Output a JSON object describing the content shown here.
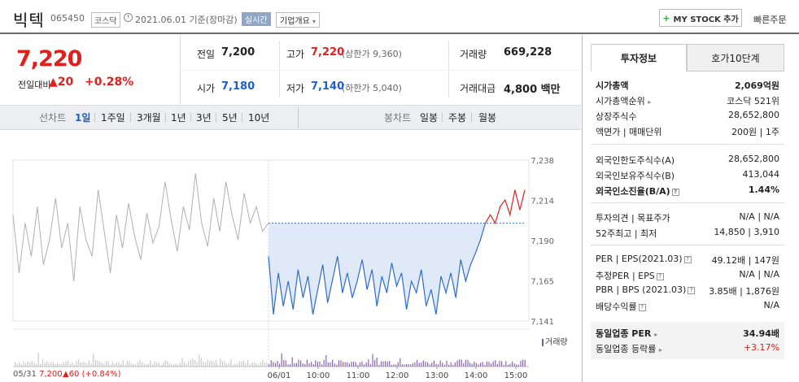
{
  "header": {
    "name": "빅텍",
    "code": "065450",
    "market": "코스닥",
    "date_text": "2021.06.01 기준(장마감)",
    "realtime": "실시간",
    "company_info": "기업개요",
    "mystock": "MY STOCK 추가",
    "quick_order": "빠른주문"
  },
  "price": {
    "current": "7,220",
    "change_label": "전일대비",
    "change_value": "20",
    "change_pct": "+0.28%"
  },
  "info": {
    "prev_label": "전일",
    "prev": "7,200",
    "open_label": "시가",
    "open": "7,180",
    "high_label": "고가",
    "high": "7,220",
    "upper_limit": "(상한가 9,360)",
    "low_label": "저가",
    "low": "7,140",
    "lower_limit": "(하한가 5,040)",
    "volume_label": "거래량",
    "volume": "669,228",
    "amount_label": "거래대금",
    "amount": "4,800 백만"
  },
  "period_tabs": {
    "label": "선차트",
    "items": [
      "1일",
      "1주일",
      "3개월",
      "1년",
      "3년",
      "5년",
      "10년"
    ],
    "active": "1일",
    "candle_label": "봉차트",
    "candle_items": [
      "일봉",
      "주봉",
      "월봉"
    ]
  },
  "chart_data": {
    "type": "line",
    "prev_close": 7200,
    "ylim": [
      7141,
      7238
    ],
    "y_ticks": [
      "7,238",
      "7,214",
      "7,190",
      "7,165",
      "7,141"
    ],
    "x_ticks": [
      "06/01",
      "10:00",
      "11:00",
      "12:00",
      "13:00",
      "14:00",
      "15:00"
    ],
    "volume_legend": "거래량",
    "footer_date": "05/31",
    "footer_price": "7,200",
    "footer_change": "▲60 (+0.84%)",
    "prev_day_series": [
      7205,
      7170,
      7200,
      7180,
      7210,
      7175,
      7190,
      7215,
      7185,
      7200,
      7165,
      7210,
      7190,
      7180,
      7220,
      7195,
      7170,
      7205,
      7185,
      7212,
      7192,
      7178,
      7206,
      7188,
      7198,
      7225,
      7202,
      7183,
      7210,
      7196,
      7230,
      7200,
      7186,
      7215,
      7195,
      7225,
      7205,
      7190,
      7218,
      7200,
      7210,
      7195,
      7200
    ],
    "today_series": [
      7180,
      7145,
      7170,
      7150,
      7165,
      7148,
      7172,
      7155,
      7168,
      7145,
      7160,
      7175,
      7152,
      7166,
      7180,
      7158,
      7170,
      7155,
      7165,
      7178,
      7160,
      7172,
      7150,
      7168,
      7158,
      7176,
      7162,
      7170,
      7148,
      7165,
      7158,
      7172,
      7150,
      7160,
      7145,
      7168,
      7158,
      7170,
      7155,
      7178,
      7165,
      7175,
      7182,
      7190,
      7200,
      7205,
      7200,
      7210,
      7214,
      7205,
      7220,
      7208,
      7220
    ]
  },
  "right": {
    "tab_invest": "투자정보",
    "tab_hoga": "호가10단계",
    "rows1": [
      {
        "label": "시가총액",
        "value": "2,069억원"
      },
      {
        "label": "시가총액순위",
        "value": "코스닥 521위"
      },
      {
        "label": "상장주식수",
        "value": "28,652,800"
      },
      {
        "label": "액면가 | 매매단위",
        "value": "200원 | 1주"
      }
    ],
    "rows2": [
      {
        "label": "외국인한도주식수(A)",
        "value": "28,652,800"
      },
      {
        "label": "외국인보유주식수(B)",
        "value": "413,044"
      },
      {
        "label": "외국인소진율(B/A)",
        "value": "1.44%"
      }
    ],
    "rows3": [
      {
        "label": "투자의견 | 목표주가",
        "value": "N/A | N/A"
      },
      {
        "label": "52주최고 | 최저",
        "value": "14,850 | 3,910"
      }
    ],
    "rows4": [
      {
        "label": "PER | EPS(2021.03)",
        "value": "49.12배 | 147원"
      },
      {
        "label": "추정PER | EPS",
        "value": "N/A | N/A"
      },
      {
        "label": "PBR | BPS (2021.03)",
        "value": "3.85배 | 1,876원"
      },
      {
        "label": "배당수익률",
        "value": "N/A"
      }
    ],
    "sector_per_label": "동일업종 PER",
    "sector_per": "34.94배",
    "sector_rate_label": "동일업종 등락률",
    "sector_rate": "+3.17%"
  }
}
